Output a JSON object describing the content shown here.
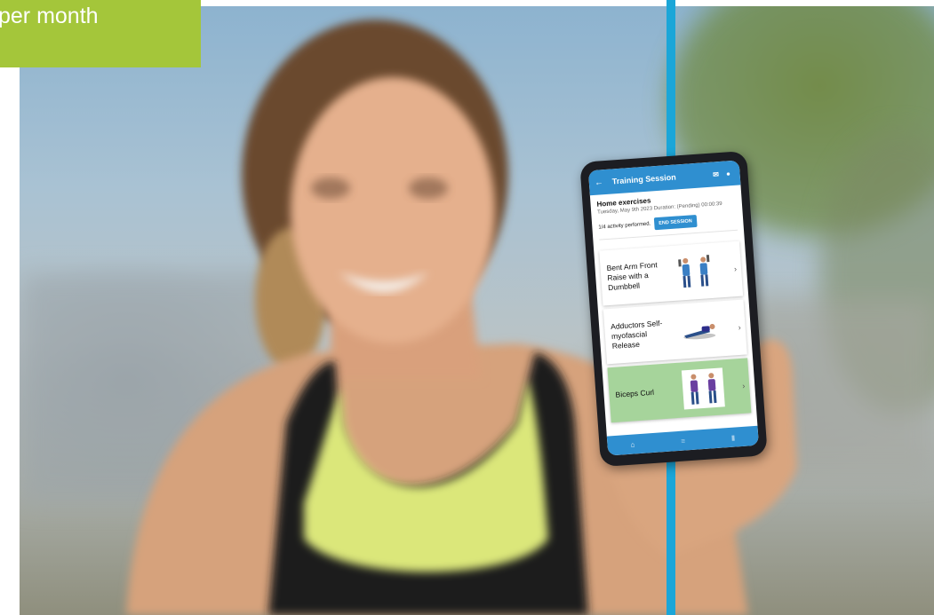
{
  "promo": {
    "text": "per month"
  },
  "app": {
    "header": {
      "title": "Training Session",
      "back_icon": "arrow-left-icon",
      "mail_icon": "mail-icon",
      "profile_icon": "user-circle-icon"
    },
    "session": {
      "name": "Home exercises",
      "meta": "Tuesday, May 9th 2023 Duration: (Pending) 00:00:39",
      "progress": "1/4 activity performed.",
      "end_button": "END SESSION"
    },
    "activities": [
      {
        "name": "Bent Arm Front Raise with a Dumbbell",
        "status": "pending"
      },
      {
        "name": "Adductors Self-myofascial Release",
        "status": "pending"
      },
      {
        "name": "Biceps Curl",
        "status": "performed"
      }
    ],
    "bottom_nav": [
      "home-icon",
      "list-icon",
      "chart-icon"
    ]
  },
  "colors": {
    "app_blue": "#2f8fd0",
    "accent_line": "#1ba6d8",
    "promo_green": "#a4c63a",
    "done_green": "#a6d49b"
  }
}
